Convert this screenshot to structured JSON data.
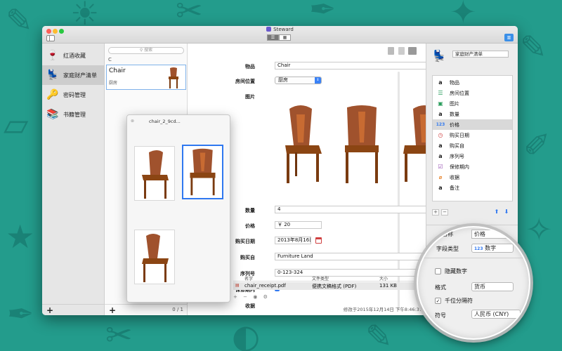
{
  "window": {
    "title": "Steward"
  },
  "categories": [
    {
      "label": "红酒收藏",
      "icon": "wine-glass-icon"
    },
    {
      "label": "家庭财产清单",
      "icon": "armchair-icon"
    },
    {
      "label": "密码管理",
      "icon": "key-icon"
    },
    {
      "label": "书籍管理",
      "icon": "books-icon"
    }
  ],
  "item_list": {
    "search_placeholder": "搜索",
    "section_letter": "C",
    "items": [
      {
        "name": "Chair",
        "room": "厨房"
      }
    ],
    "count_label": "0 / 1"
  },
  "popover": {
    "title": "chair_2_9cd..."
  },
  "detail": {
    "labels": {
      "name": "物品",
      "room": "房间位置",
      "image": "图片",
      "quantity": "数量",
      "price": "价格",
      "purchase_date": "购买日期",
      "purchased_from": "购买自",
      "serial": "序列号",
      "warranty": "保修期内",
      "receipt": "收据"
    },
    "values": {
      "name": "Chair",
      "room": "厨房",
      "quantity": "4",
      "price": "￥ 20",
      "purchase_date": "2013年8月16日",
      "purchased_from": "Furniture Land",
      "serial": "0-123-324"
    },
    "file_table": {
      "headers": [
        "名字",
        "文件类型",
        "大小"
      ],
      "rows": [
        {
          "name": "chair_receipt.pdf",
          "type": "便携文稿格式 (PDF)",
          "size": "131 KB"
        }
      ]
    },
    "status": "修改于2015年12月14日 下午8:46:37"
  },
  "right_panel": {
    "template_name": "家庭财产清单",
    "fields": [
      {
        "label": "物品",
        "icon": "text-a-icon",
        "type_glyph": "a"
      },
      {
        "label": "房间位置",
        "icon": "list-icon",
        "type_glyph": "☰"
      },
      {
        "label": "图片",
        "icon": "image-icon",
        "type_glyph": "▣"
      },
      {
        "label": "数量",
        "icon": "text-a-icon",
        "type_glyph": "a"
      },
      {
        "label": "价格",
        "icon": "number-123-icon",
        "type_glyph": "123"
      },
      {
        "label": "购买日期",
        "icon": "clock-icon",
        "type_glyph": "◷"
      },
      {
        "label": "购买自",
        "icon": "text-a-icon",
        "type_glyph": "a"
      },
      {
        "label": "序列号",
        "icon": "text-a-icon",
        "type_glyph": "a"
      },
      {
        "label": "保修期内",
        "icon": "checkbox-icon",
        "type_glyph": "☑"
      },
      {
        "label": "收据",
        "icon": "paperclip-icon",
        "type_glyph": "⌀"
      },
      {
        "label": "备注",
        "icon": "text-a-icon",
        "type_glyph": "a"
      }
    ],
    "selected_field_index": 4
  },
  "magnifier": {
    "field_name_label": "字段名称",
    "field_name_value": "价格",
    "field_type_label": "字段类型",
    "field_type_value": "数字",
    "field_type_glyph": "123",
    "hide_number_label": "隐藏数字",
    "format_label": "格式",
    "format_value": "货币",
    "thousands_sep_label": "千位分隔符",
    "symbol_label": "符号",
    "symbol_value": "人民币 (CNY)"
  },
  "colors": {
    "accent": "#2f78f0",
    "wallpaper": "#239c8c",
    "selection": "#d9d9d9"
  }
}
